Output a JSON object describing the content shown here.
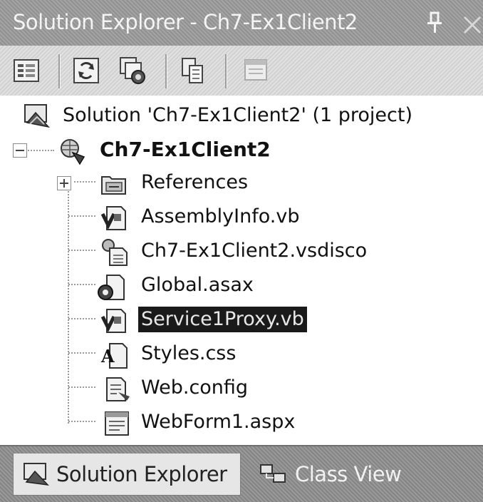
{
  "window": {
    "title": "Solution Explorer - Ch7-Ex1Client2"
  },
  "toolbar": {
    "buttons": [
      {
        "icon": "properties-icon"
      },
      {
        "icon": "refresh-icon"
      },
      {
        "icon": "show-all-files-icon"
      },
      {
        "icon": "copy-project-icon"
      },
      {
        "icon": "view-designer-icon"
      }
    ]
  },
  "tree": {
    "solution": "Solution 'Ch7-Ex1Client2' (1 project)",
    "project": "Ch7-Ex1Client2",
    "items": [
      {
        "label": "References",
        "icon": "references-folder-icon",
        "expandable": true
      },
      {
        "label": "AssemblyInfo.vb",
        "icon": "vb-file-icon"
      },
      {
        "label": "Ch7-Ex1Client2.vsdisco",
        "icon": "vsdisco-file-icon"
      },
      {
        "label": "Global.asax",
        "icon": "global-asax-icon"
      },
      {
        "label": "Service1Proxy.vb",
        "icon": "vb-file-icon",
        "selected": true
      },
      {
        "label": "Styles.css",
        "icon": "stylesheet-icon"
      },
      {
        "label": "Web.config",
        "icon": "config-file-icon"
      },
      {
        "label": "WebForm1.aspx",
        "icon": "webform-icon"
      }
    ]
  },
  "tabs": {
    "solution_explorer": "Solution Explorer",
    "class_view": "Class View"
  },
  "colors": {
    "selection_bg": "#1a1a1a",
    "titlebar_bg": "#9a9a9a"
  }
}
